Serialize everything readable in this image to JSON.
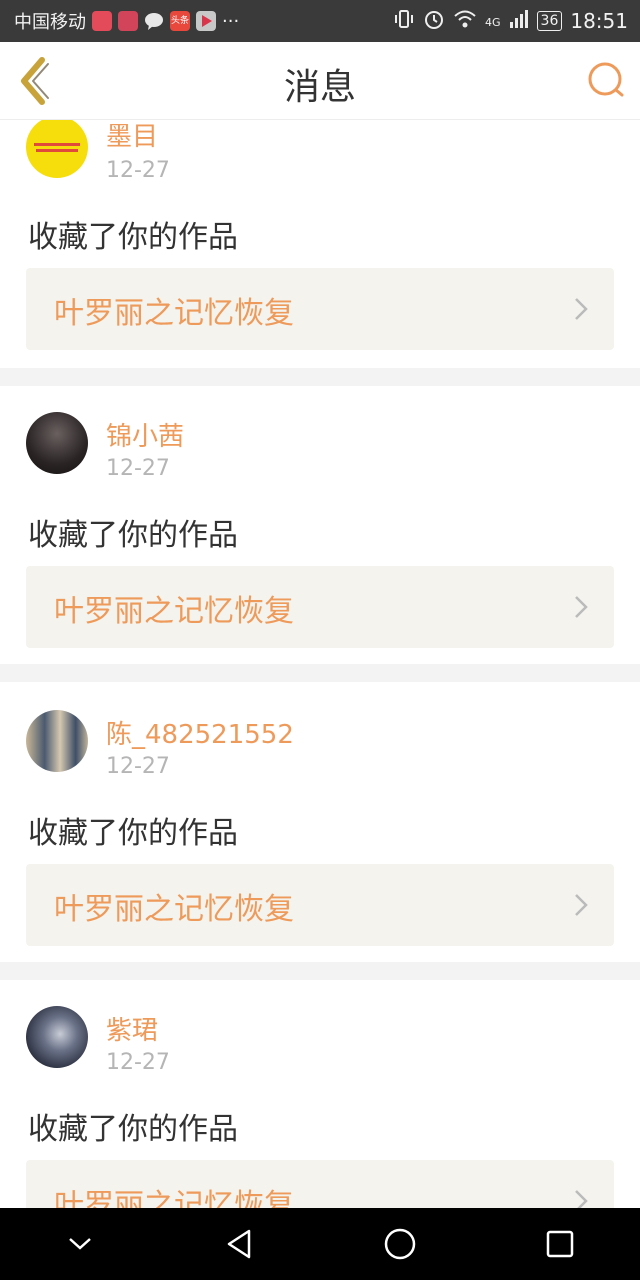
{
  "status_bar": {
    "carrier": "中国移动",
    "toutiao_label": "头条",
    "more": "···",
    "network": "4G",
    "battery": "36",
    "time": "18:51"
  },
  "header": {
    "title": "消息"
  },
  "messages": [
    {
      "username": "墨目",
      "date": "12-27",
      "action": "收藏了你的作品",
      "work_title": "叶罗丽之记忆恢复"
    },
    {
      "username": "锦小茜",
      "date": "12-27",
      "action": "收藏了你的作品",
      "work_title": "叶罗丽之记忆恢复"
    },
    {
      "username": "陈_482521552",
      "date": "12-27",
      "action": "收藏了你的作品",
      "work_title": "叶罗丽之记忆恢复"
    },
    {
      "username": "紫珺",
      "date": "12-27",
      "action": "收藏了你的作品",
      "work_title": "叶罗丽之记忆恢复"
    }
  ],
  "colors": {
    "accent": "#ee9a5a",
    "back_arrow": "#c8a33a",
    "card_box": "#f4f3ee",
    "separator": "#f3f3f3"
  },
  "icons": {
    "back": "chevron-left-icon",
    "search": "search-icon",
    "nav_down": "chevron-down-icon",
    "nav_back": "triangle-back-icon",
    "nav_home": "circle-home-icon",
    "nav_recent": "square-recent-icon"
  }
}
